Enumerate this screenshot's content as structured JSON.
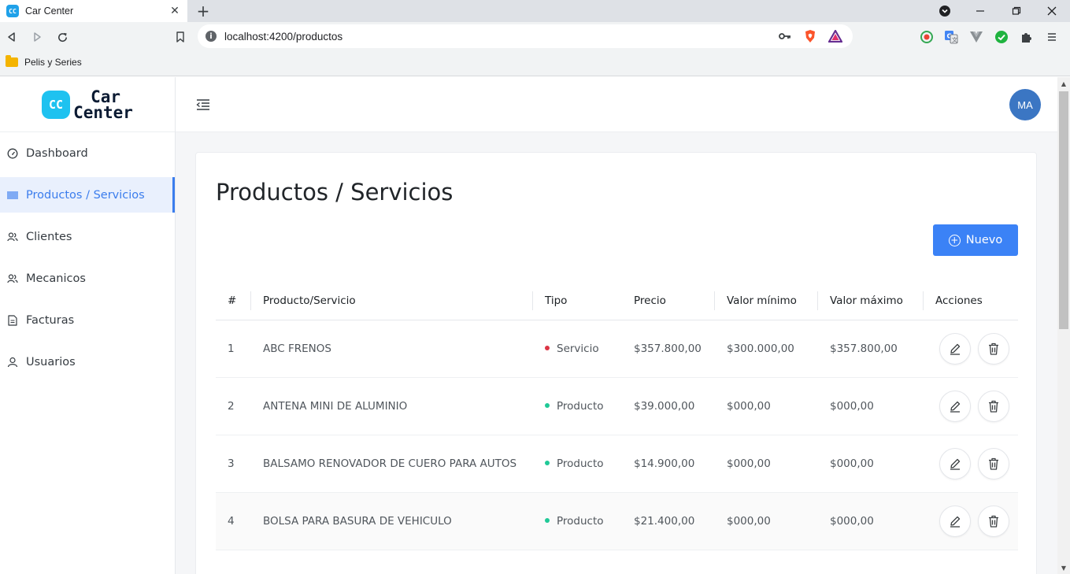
{
  "browser": {
    "tab_title": "Car Center",
    "tab_favicon": "CC",
    "url": "localhost:4200/productos",
    "bookmark": "Pelis y Series"
  },
  "app": {
    "logo_mark": "CC",
    "logo_line1": "Car",
    "logo_line2": "Center",
    "avatar": "MA",
    "accent": "#3b82f6"
  },
  "sidebar": {
    "items": [
      {
        "label": "Dashboard",
        "icon": "gauge-icon"
      },
      {
        "label": "Productos / Servicios",
        "icon": "barcode-icon",
        "active": true
      },
      {
        "label": "Clientes",
        "icon": "users-icon"
      },
      {
        "label": "Mecanicos",
        "icon": "users-icon"
      },
      {
        "label": "Facturas",
        "icon": "document-icon"
      },
      {
        "label": "Usuarios",
        "icon": "user-icon"
      }
    ]
  },
  "page": {
    "title": "Productos / Servicios",
    "new_button": "Nuevo"
  },
  "table": {
    "headers": [
      "#",
      "Producto/Servicio",
      "Tipo",
      "Precio",
      "Valor mínimo",
      "Valor máximo",
      "Acciones"
    ],
    "rows": [
      {
        "n": "1",
        "name": "ABC FRENOS",
        "type": "Servicio",
        "type_color": "#dc3545",
        "price": "$357.800,00",
        "min": "$300.000,00",
        "max": "$357.800,00"
      },
      {
        "n": "2",
        "name": "ANTENA MINI DE ALUMINIO",
        "type": "Producto",
        "type_color": "#20c997",
        "price": "$39.000,00",
        "min": "$000,00",
        "max": "$000,00"
      },
      {
        "n": "3",
        "name": "BALSAMO RENOVADOR DE CUERO PARA AUTOS",
        "type": "Producto",
        "type_color": "#20c997",
        "price": "$14.900,00",
        "min": "$000,00",
        "max": "$000,00"
      },
      {
        "n": "4",
        "name": "BOLSA PARA BASURA DE VEHICULO",
        "type": "Producto",
        "type_color": "#20c997",
        "price": "$21.400,00",
        "min": "$000,00",
        "max": "$000,00"
      }
    ]
  }
}
